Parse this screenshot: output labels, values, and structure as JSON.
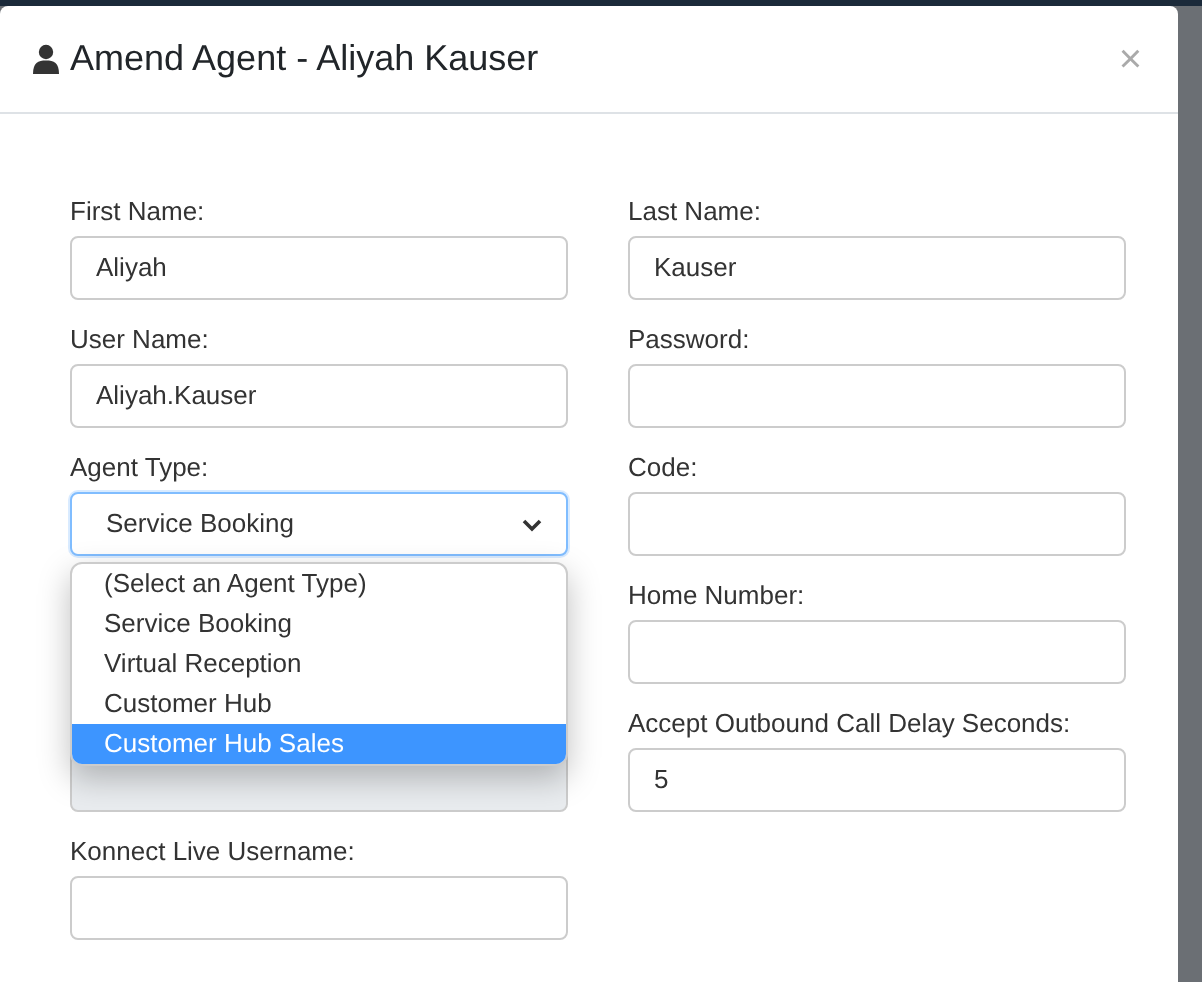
{
  "dialog": {
    "title": "Amend Agent - Aliyah Kauser",
    "close": "×"
  },
  "fields": [
    {
      "label": "First Name:",
      "value": "Aliyah",
      "kind": "text",
      "disabled": false
    },
    {
      "label": "Last Name:",
      "value": "Kauser",
      "kind": "text",
      "disabled": false
    },
    {
      "label": "User Name:",
      "value": "Aliyah.Kauser",
      "kind": "text",
      "disabled": false
    },
    {
      "label": "Password:",
      "kind": "text",
      "disabled": false
    },
    {
      "label": "Agent Type:",
      "value": "Service Booking",
      "kind": "select",
      "disabled": false,
      "open": true,
      "options": [
        {
          "label": "(Select an Agent Type)",
          "highlighted": false
        },
        {
          "label": "Service Booking",
          "highlighted": false
        },
        {
          "label": "Virtual Reception",
          "highlighted": false
        },
        {
          "label": "Customer Hub",
          "highlighted": false
        },
        {
          "label": "Customer Hub Sales",
          "highlighted": true
        }
      ]
    },
    {
      "label": "Code:",
      "kind": "text",
      "disabled": false
    },
    {
      "kind": "blank"
    },
    {
      "label": "Home Number:",
      "kind": "text",
      "disabled": false
    },
    {
      "kind": "text",
      "disabled": true
    },
    {
      "label": "Accept Outbound Call Delay Seconds:",
      "value": "5",
      "kind": "text",
      "disabled": false
    },
    {
      "label": "Konnect Live Username:",
      "kind": "text",
      "disabled": false
    }
  ]
}
